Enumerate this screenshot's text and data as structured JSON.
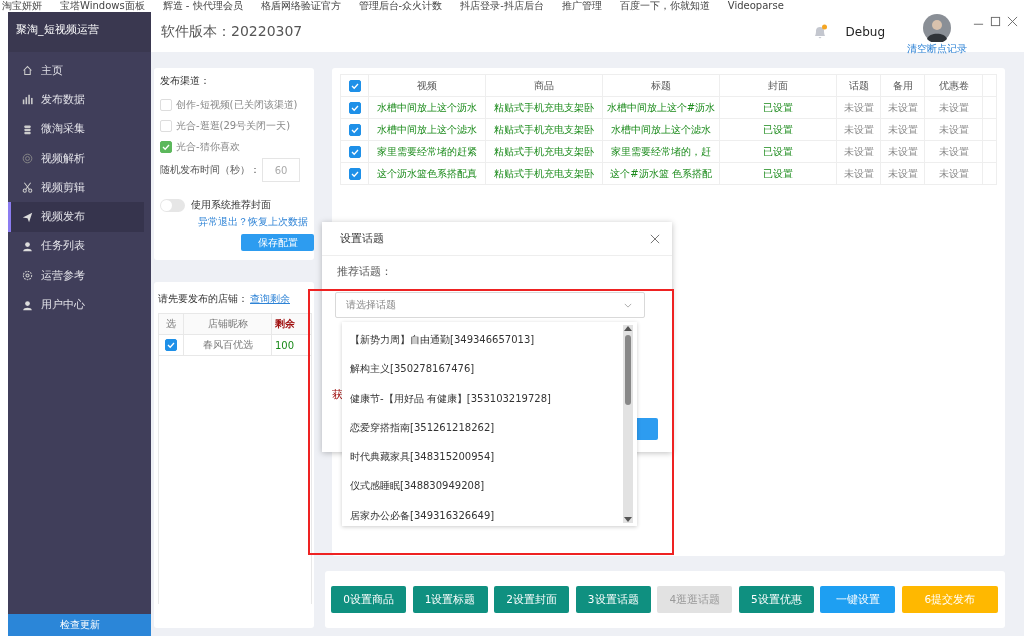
{
  "bookmarks": [
    "淘宝妍妍",
    "宝塔Windows面板",
    "辉造 - 快代理会员",
    "格盾网络验证官方",
    "管理后台-众火计数",
    "抖店登录-抖店后台",
    "推广管理",
    "百度一下，你就知道",
    "Videoparse"
  ],
  "app": {
    "title": "聚淘_短视频运营",
    "version": "软件版本：20220307",
    "user": "Debug",
    "clear_link": "清空断点记录",
    "has_notification": true
  },
  "sidebar": {
    "items": [
      {
        "label": "主页",
        "selected": false
      },
      {
        "label": "发布数据",
        "selected": false
      },
      {
        "label": "微淘采集",
        "selected": false
      },
      {
        "label": "视频解析",
        "selected": false
      },
      {
        "label": "视频剪辑",
        "selected": false
      },
      {
        "label": "视频发布",
        "selected": true
      },
      {
        "label": "任务列表",
        "selected": false
      },
      {
        "label": "运营参考",
        "selected": false
      },
      {
        "label": "用户中心",
        "selected": false
      }
    ],
    "update_button": "检查更新"
  },
  "channels": {
    "title": "发布渠道：",
    "options": [
      {
        "label": "创作-短视频(已关闭该渠道)",
        "checked": false
      },
      {
        "label": "光合-逛逛(29号关闭一天)",
        "checked": false
      },
      {
        "label": "光合-猜你喜欢",
        "checked": true
      }
    ],
    "interval_label": "随机发布时间（秒）：",
    "interval_value": "60",
    "cover_toggle": {
      "label": "使用系统推荐封面",
      "on": false
    },
    "restore_link": "异常退出？恢复上次数据",
    "save_button": "保存配置"
  },
  "stores": {
    "title": "请先要发布的店铺：",
    "query_link": "查询剩余",
    "columns": [
      "选",
      "店铺昵称",
      "剩余"
    ],
    "rows": [
      {
        "checked": true,
        "name": "春风百优选",
        "remaining": "100"
      }
    ]
  },
  "table": {
    "all_checked": true,
    "columns": [
      "视频",
      "商品",
      "标题",
      "封面",
      "话题",
      "备用",
      "优惠卷"
    ],
    "rows": [
      {
        "checked": true,
        "cells": [
          {
            "text": "水槽中间放上这个沥水",
            "set": true
          },
          {
            "text": "粘贴式手机充电支架卧",
            "set": true
          },
          {
            "text": "水槽中间放上这个#沥水",
            "set": true
          },
          {
            "text": "已设置",
            "set": true
          },
          {
            "text": "未设置",
            "set": false
          },
          {
            "text": "未设置",
            "set": false
          },
          {
            "text": "未设置",
            "set": false
          }
        ]
      },
      {
        "checked": true,
        "cells": [
          {
            "text": "水槽中间放上这个滤水",
            "set": true
          },
          {
            "text": "粘贴式手机充电支架卧",
            "set": true
          },
          {
            "text": "水槽中间放上这个滤水",
            "set": true
          },
          {
            "text": "已设置",
            "set": true
          },
          {
            "text": "未设置",
            "set": false
          },
          {
            "text": "未设置",
            "set": false
          },
          {
            "text": "未设置",
            "set": false
          }
        ]
      },
      {
        "checked": true,
        "cells": [
          {
            "text": "家里需要经常堵的赶紧",
            "set": true
          },
          {
            "text": "粘贴式手机充电支架卧",
            "set": true
          },
          {
            "text": "家里需要经常堵的，赶",
            "set": true
          },
          {
            "text": "已设置",
            "set": true
          },
          {
            "text": "未设置",
            "set": false
          },
          {
            "text": "未设置",
            "set": false
          },
          {
            "text": "未设置",
            "set": false
          }
        ]
      },
      {
        "checked": true,
        "cells": [
          {
            "text": "这个沥水篮色系搭配真",
            "set": true
          },
          {
            "text": "粘贴式手机充电支架卧",
            "set": true
          },
          {
            "text": "这个#沥水篮 色系搭配",
            "set": true
          },
          {
            "text": "已设置",
            "set": true
          },
          {
            "text": "未设置",
            "set": false
          },
          {
            "text": "未设置",
            "set": false
          },
          {
            "text": "未设置",
            "set": false
          }
        ]
      }
    ]
  },
  "actions": [
    {
      "label": "0设置商品",
      "kind": "primary",
      "disabled": false
    },
    {
      "label": "1设置标题",
      "kind": "primary",
      "disabled": false
    },
    {
      "label": "2设置封面",
      "kind": "primary",
      "disabled": false
    },
    {
      "label": "3设置话题",
      "kind": "primary",
      "disabled": false
    },
    {
      "label": "4逛逛话题",
      "kind": "primary",
      "disabled": true
    },
    {
      "label": "5设置优惠",
      "kind": "primary",
      "disabled": false
    },
    {
      "label": "一键设置",
      "kind": "info",
      "disabled": false
    },
    {
      "label": "6提交发布",
      "kind": "warning",
      "disabled": false
    }
  ],
  "dialog": {
    "title": "设置话题",
    "label": "推荐话题：",
    "select_placeholder": "请选择话题",
    "hint_fragment": "获",
    "options": [
      "【新势力周】自由通勤[349346657013]",
      "解构主义[350278167476]",
      "健康节-【用好品 有健康】[353103219728]",
      "恋爱穿搭指南[351261218262]",
      "时代典藏家具[348315200954]",
      "仪式感睡眠[348830949208]",
      "居家办公必备[349316326649]"
    ]
  }
}
